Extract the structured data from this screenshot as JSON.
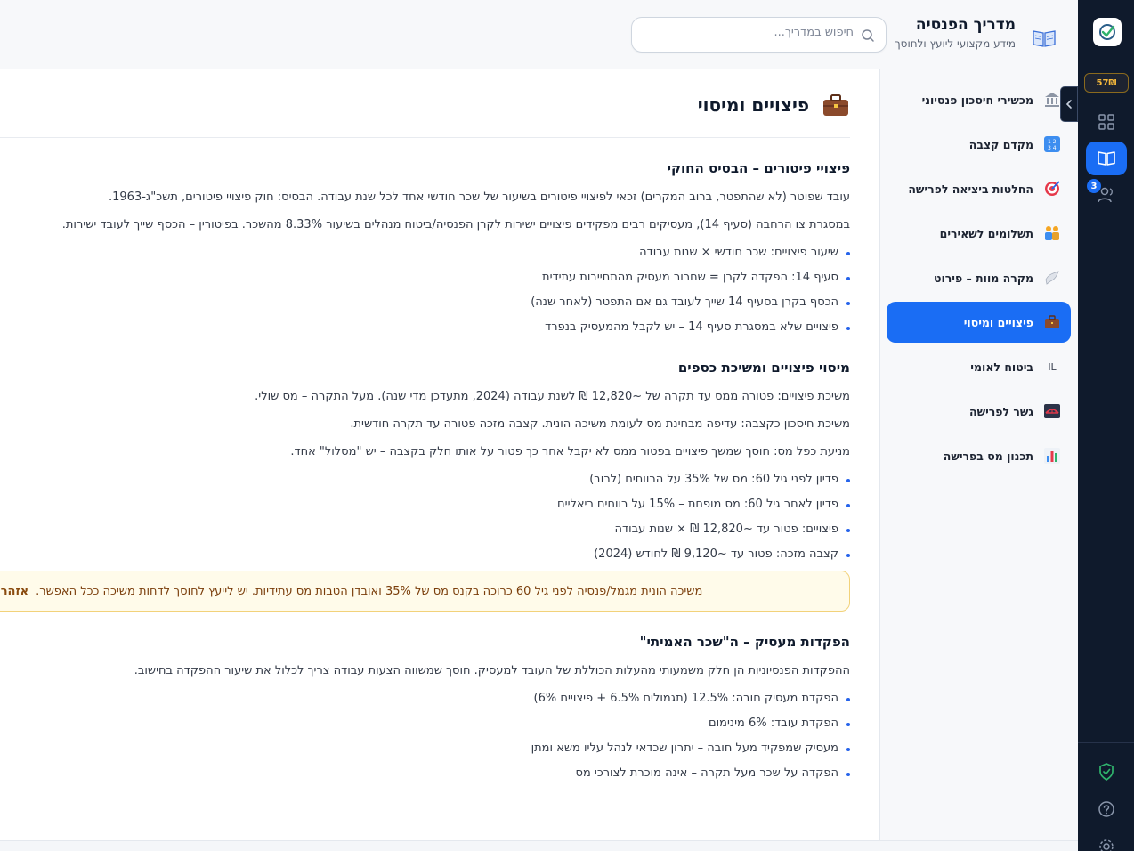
{
  "header": {
    "brand_title": "מדריך הפנסיה",
    "brand_subtitle": "מידע מקצועי ליועץ ולחוסך",
    "search_placeholder": "חיפוש במדריך..."
  },
  "rail": {
    "badge": "57₪",
    "notification_count": "3"
  },
  "sidebar": {
    "items": [
      {
        "label": "מכשירי חיסכון פנסיוני",
        "icon": "bank-icon"
      },
      {
        "label": "מקדם קצבה",
        "icon": "numbers-icon"
      },
      {
        "label": "החלטות ביציאה לפרישה",
        "icon": "target-icon"
      },
      {
        "label": "תשלומים לשאירים",
        "icon": "family-icon"
      },
      {
        "label": "מקרה מוות – פירוט",
        "icon": "dove-icon"
      },
      {
        "label": "פיצויים ומיסוי",
        "icon": "briefcase-icon",
        "active": true
      },
      {
        "label": "ביטוח לאומי",
        "icon": "il-icon",
        "icon_text": "IL"
      },
      {
        "label": "גשר לפרישה",
        "icon": "bridge-icon"
      },
      {
        "label": "תכנון מס בפרישה",
        "icon": "bar-chart-icon"
      }
    ]
  },
  "page": {
    "title": "פיצויים ומיסוי"
  },
  "section1": {
    "heading": "פיצויי פיטורים – הבסיס החוקי",
    "p1": "עובד שפוטר (לא שהתפטר, ברוב המקרים) זכאי לפיצויי פיטורים בשיעור של שכר חודשי אחד לכל שנת עבודה. הבסיס: חוק פיצויי פיטורים, תשכ\"ג-1963.",
    "p2": "במסגרת צו הרחבה (סעיף 14), מעסיקים רבים מפקידים פיצויים ישירות לקרן הפנסיה/ביטוח מנהלים בשיעור 8.33% מהשכר. בפיטורין – הכסף שייך לעובד ישירות.",
    "bullets": [
      "שיעור פיצויים: שכר חודשי × שנות עבודה",
      "סעיף 14: הפקדה לקרן = שחרור מעסיק מהתחייבות עתידית",
      "הכסף בקרן בסעיף 14 שייך לעובד גם אם התפטר (לאחר שנה)",
      "פיצויים שלא במסגרת סעיף 14 – יש לקבל מהמעסיק בנפרד"
    ]
  },
  "section2": {
    "heading": "מיסוי פיצויים ומשיכת כספים",
    "p1": "משיכת פיצויים: פטורה ממס עד תקרה של ~12,820 ₪ לשנת עבודה (2024, מתעדכן מדי שנה). מעל התקרה – מס שולי.",
    "p2": "משיכת חיסכון כקצבה: עדיפה מבחינת מס לעומת משיכה הונית. קצבה מזכה פטורה עד תקרה חודשית.",
    "p3": "מניעת כפל מס: חוסך שמשך פיצויים בפטור ממס לא יקבל אחר כך פטור על אותו חלק בקצבה – יש \"מסלול\" אחד.",
    "bullets": [
      "פדיון לפני גיל 60: מס של 35% על הרווחים (לרוב)",
      "פדיון לאחר גיל 60: מס מופחת – 15% על רווחים ריאליים",
      "פיצויים: פטור עד ~12,820 ₪ × שנות עבודה",
      "קצבה מזכה: פטור עד ~9,120 ₪ לחודש (2024)"
    ]
  },
  "warning": {
    "label": "אזהרה:",
    "text": "משיכה הונית מגמל/פנסיה לפני גיל 60 כרוכה בקנס מס של 35% ואובדן הטבות מס עתידיות. יש לייעץ לחוסך לדחות משיכה ככל האפשר."
  },
  "section3": {
    "heading": "הפקדות מעסיק – ה\"שכר האמיתי\"",
    "p1": "ההפקדות הפנסיוניות הן חלק משמעותי מהעלות הכוללת של העובד למעסיק. חוסך שמשווה הצעות עבודה צריך לכלול את שיעור ההפקדה בחישוב.",
    "bullets": [
      "הפקדת מעסיק חובה: 12.5% (תגמולים 6.5% + פיצויים 6%)",
      "הפקדת עובד: 6% מינימום",
      "מעסיק שמפקיד מעל חובה – יתרון שכדאי לנהל עליו משא ומתן",
      "הפקדה על שכר מעל תקרה – אינה מוכרת לצורכי מס"
    ]
  }
}
